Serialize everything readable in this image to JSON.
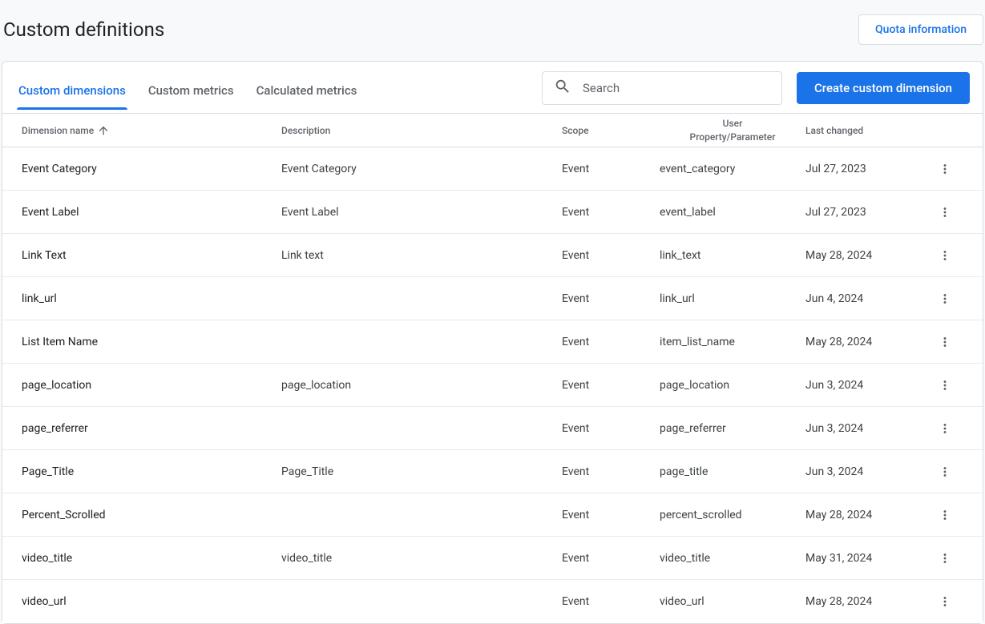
{
  "header": {
    "title": "Custom definitions",
    "quota_label": "Quota information"
  },
  "tabs": {
    "dimensions": "Custom dimensions",
    "metrics": "Custom metrics",
    "calculated": "Calculated metrics"
  },
  "search": {
    "placeholder": "Search"
  },
  "create_label": "Create custom dimension",
  "columns": {
    "name": "Dimension name",
    "description": "Description",
    "scope": "Scope",
    "prop_line1": "User",
    "prop_line2": "Property/Parameter",
    "last_changed": "Last changed"
  },
  "rows": [
    {
      "name": "Event Category",
      "description": "Event Category",
      "scope": "Event",
      "prop": "event_category",
      "date": "Jul 27, 2023"
    },
    {
      "name": "Event Label",
      "description": "Event Label",
      "scope": "Event",
      "prop": "event_label",
      "date": "Jul 27, 2023"
    },
    {
      "name": "Link Text",
      "description": "Link text",
      "scope": "Event",
      "prop": "link_text",
      "date": "May 28, 2024"
    },
    {
      "name": "link_url",
      "description": "",
      "scope": "Event",
      "prop": "link_url",
      "date": "Jun 4, 2024"
    },
    {
      "name": "List Item Name",
      "description": "",
      "scope": "Event",
      "prop": "item_list_name",
      "date": "May 28, 2024"
    },
    {
      "name": "page_location",
      "description": "page_location",
      "scope": "Event",
      "prop": "page_location",
      "date": "Jun 3, 2024"
    },
    {
      "name": "page_referrer",
      "description": "",
      "scope": "Event",
      "prop": "page_referrer",
      "date": "Jun 3, 2024"
    },
    {
      "name": "Page_Title",
      "description": "Page_Title",
      "scope": "Event",
      "prop": "page_title",
      "date": "Jun 3, 2024"
    },
    {
      "name": "Percent_Scrolled",
      "description": "",
      "scope": "Event",
      "prop": "percent_scrolled",
      "date": "May 28, 2024"
    },
    {
      "name": "video_title",
      "description": "video_title",
      "scope": "Event",
      "prop": "video_title",
      "date": "May 31, 2024"
    },
    {
      "name": "video_url",
      "description": "",
      "scope": "Event",
      "prop": "video_url",
      "date": "May 28, 2024"
    }
  ]
}
